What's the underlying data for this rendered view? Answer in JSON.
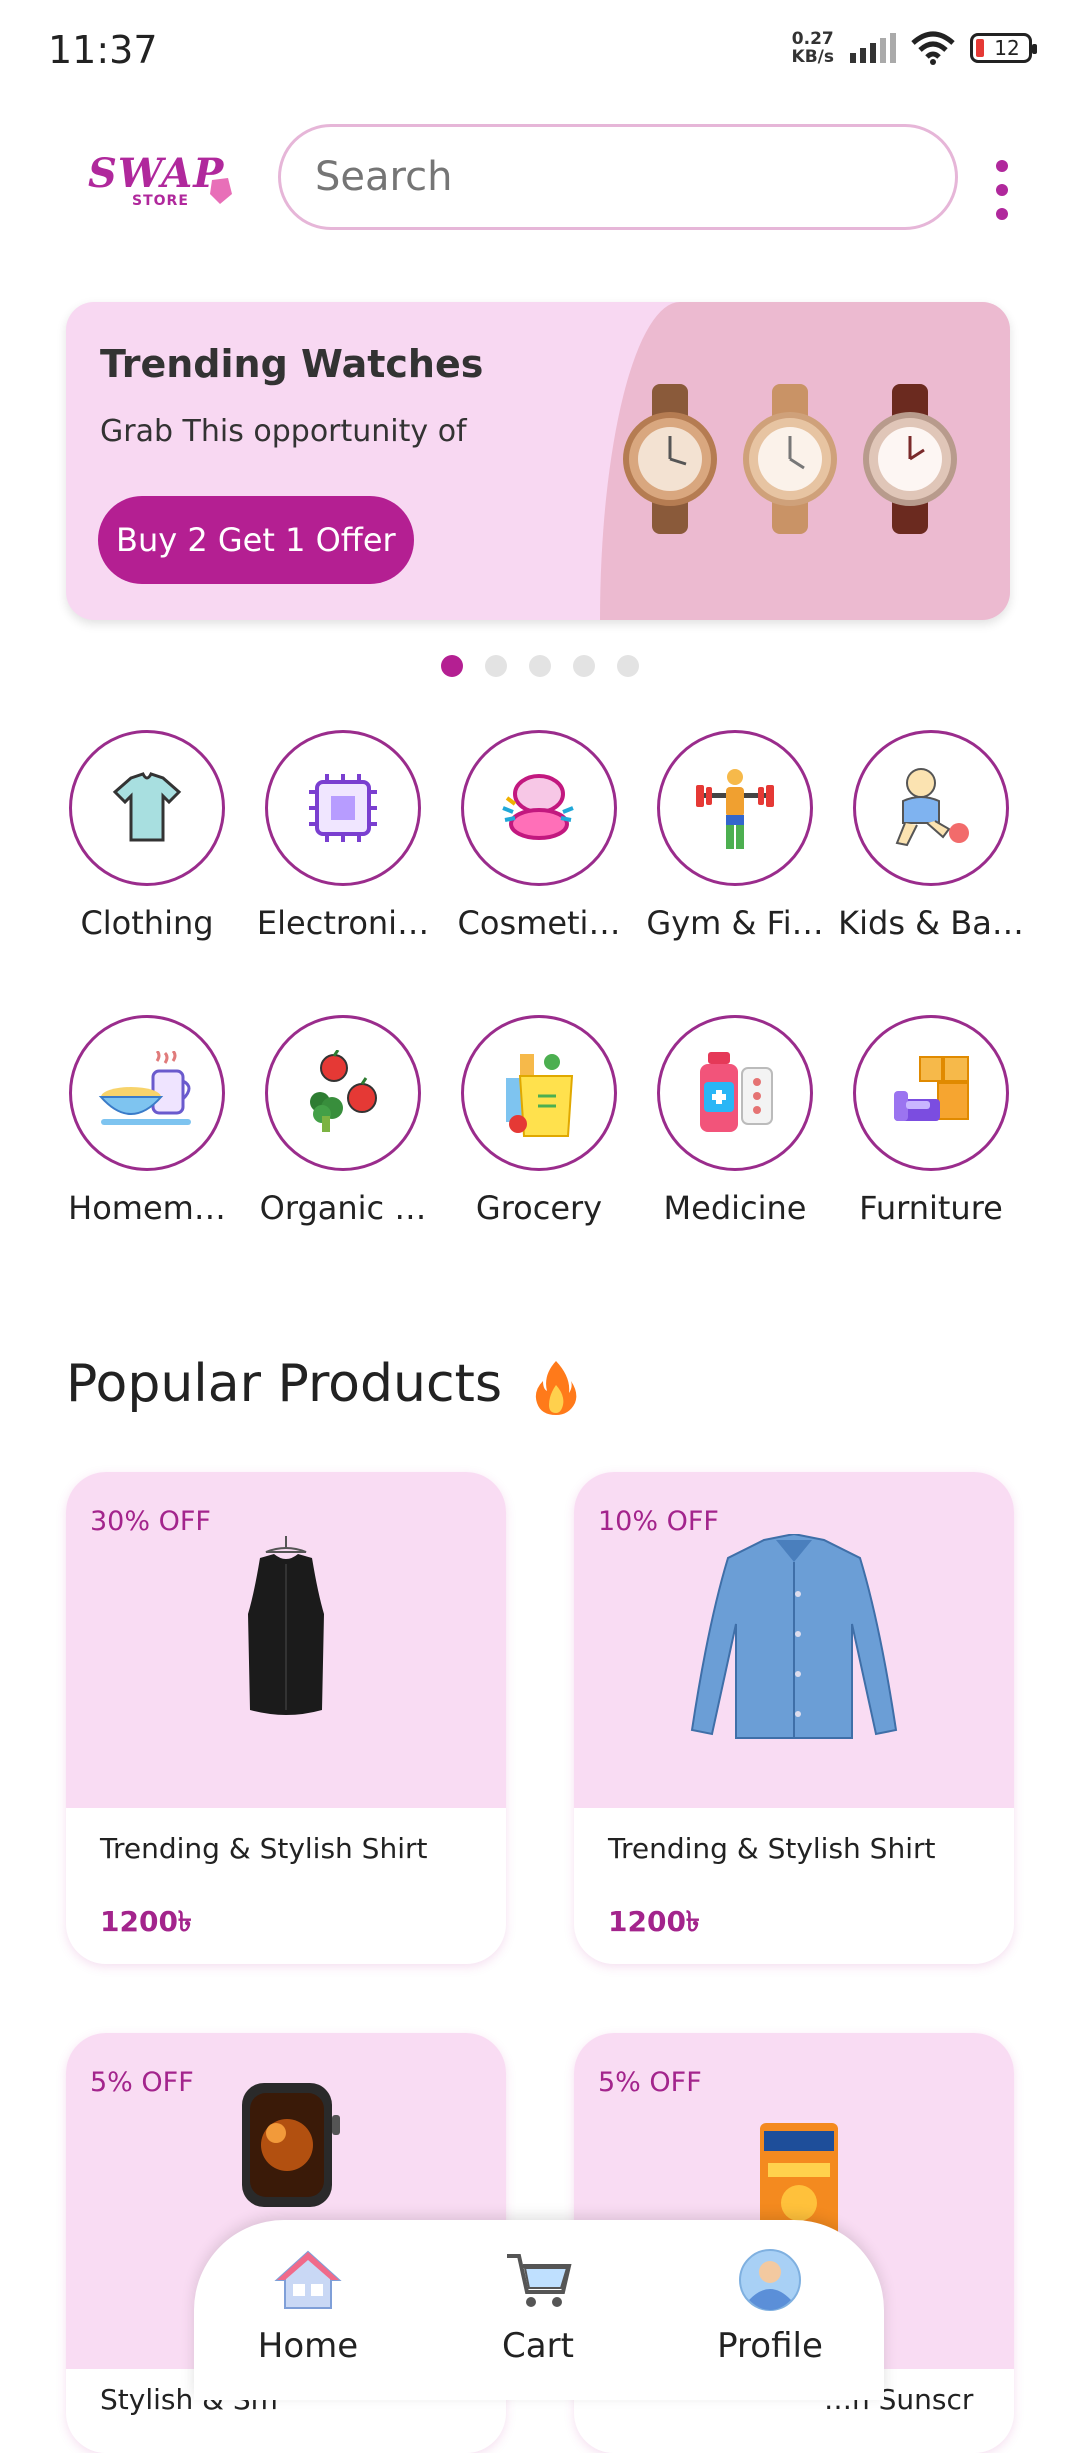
{
  "status": {
    "time": "11:37",
    "speed_value": "0.27",
    "speed_unit": "KB/s",
    "battery": "12"
  },
  "header": {
    "logo_text": "SWAP",
    "logo_sub": "STORE",
    "search_placeholder": "Search"
  },
  "banner": {
    "title": "Trending Watches",
    "subtitle": "Grab This opportunity of",
    "button": "Buy 2 Get 1 Offer",
    "pages": 5,
    "active_page": 1
  },
  "categories": [
    {
      "label": "Clothing",
      "icon": "tshirt-icon"
    },
    {
      "label": "Electroni…",
      "icon": "chip-icon"
    },
    {
      "label": "Cosmeti…",
      "icon": "compact-icon"
    },
    {
      "label": "Gym & Fi…",
      "icon": "weightlifter-icon"
    },
    {
      "label": "Kids & Ba…",
      "icon": "child-icon"
    },
    {
      "label": "Homem…",
      "icon": "breakfast-icon"
    },
    {
      "label": "Organic …",
      "icon": "vegetables-icon"
    },
    {
      "label": "Grocery",
      "icon": "grocery-bag-icon"
    },
    {
      "label": "Medicine",
      "icon": "medicine-icon"
    },
    {
      "label": "Furniture",
      "icon": "furniture-icon"
    }
  ],
  "popular": {
    "title": "Popular Products",
    "icon": "fire-icon",
    "products": [
      {
        "discount": "30% OFF",
        "title": "Trending & Stylish Shirt",
        "price": "1200৳",
        "image": "black-vest-image"
      },
      {
        "discount": "10% OFF",
        "title": "Trending & Stylish Shirt",
        "price": "1200৳",
        "image": "blue-shirt-image"
      },
      {
        "discount": "5% OFF",
        "title": "Stylish & Sm",
        "price": "",
        "image": "smartwatch-image"
      },
      {
        "discount": "5% OFF",
        "title": "…n Sunscr",
        "price": "",
        "image": "sunscreen-image"
      }
    ]
  },
  "nav": {
    "items": [
      {
        "label": "Home",
        "icon": "home-icon"
      },
      {
        "label": "Cart",
        "icon": "cart-icon"
      },
      {
        "label": "Profile",
        "icon": "profile-icon"
      }
    ]
  },
  "colors": {
    "accent": "#b41f92",
    "card_bg": "#f9dcf3",
    "banner_bg": "#f8d8f2"
  }
}
